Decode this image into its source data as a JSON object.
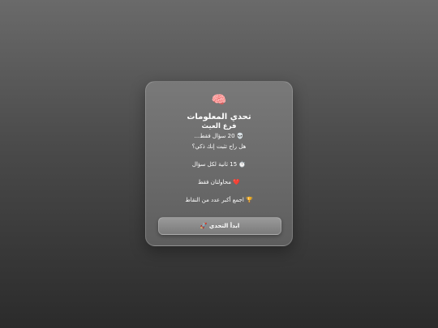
{
  "card": {
    "icon": "🧠",
    "title": "تحدي المعلومات",
    "subtitle": "فرع العيث",
    "lines": [
      {
        "icon": "💀",
        "text": "20 سؤال فقط..."
      },
      {
        "icon": "",
        "text": "هل راح تثبت إنك ذكي؟"
      },
      {
        "icon": "⏱️",
        "text": "15 ثانية لكل سؤال"
      },
      {
        "icon": "❤️",
        "text": "محاولتان فقط"
      },
      {
        "icon": "🏆",
        "text": "اجمع أكبر عدد من النقاط"
      }
    ],
    "start_button": {
      "icon": "🚀",
      "label": "ابدأ التحدي"
    }
  }
}
